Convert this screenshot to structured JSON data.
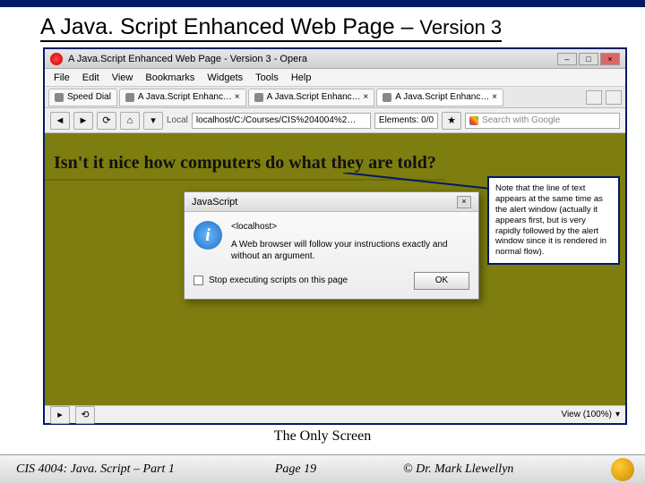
{
  "slide": {
    "title_main": "A Java. Script Enhanced Web Page – ",
    "title_suffix": "Version 3",
    "caption": "The Only Screen"
  },
  "browser": {
    "window_title": "A Java.Script Enhanced Web Page - Version 3 - Opera",
    "menus": [
      "File",
      "Edit",
      "View",
      "Bookmarks",
      "Widgets",
      "Tools",
      "Help"
    ],
    "tabs": [
      {
        "label": "Speed Dial"
      },
      {
        "label": "A Java.Script Enhanc… ×"
      },
      {
        "label": "A Java.Script Enhanc… ×"
      },
      {
        "label": "A Java.Script Enhanc… ×"
      }
    ],
    "address_prefix": "Local",
    "address": "localhost/C:/Courses/CIS%204004%2…",
    "elements": "Elements: 0/0",
    "search_placeholder": "Search with Google",
    "zoom": "View (100%)"
  },
  "page": {
    "headline": "Isn't it nice how computers do what they are told?"
  },
  "dialog": {
    "title": "JavaScript",
    "host": "<localhost>",
    "message": "A Web browser will follow your instructions exactly and without an argument.",
    "checkbox_label": "Stop executing scripts on this page",
    "ok": "OK"
  },
  "callout": {
    "text": "Note that the line of text appears at the same time as the alert window (actually it appears first, but is very rapidly followed by the alert window since it is rendered in normal flow)."
  },
  "footer": {
    "left": "CIS 4004: Java. Script – Part 1",
    "center": "Page 19",
    "right": "© Dr. Mark Llewellyn"
  }
}
